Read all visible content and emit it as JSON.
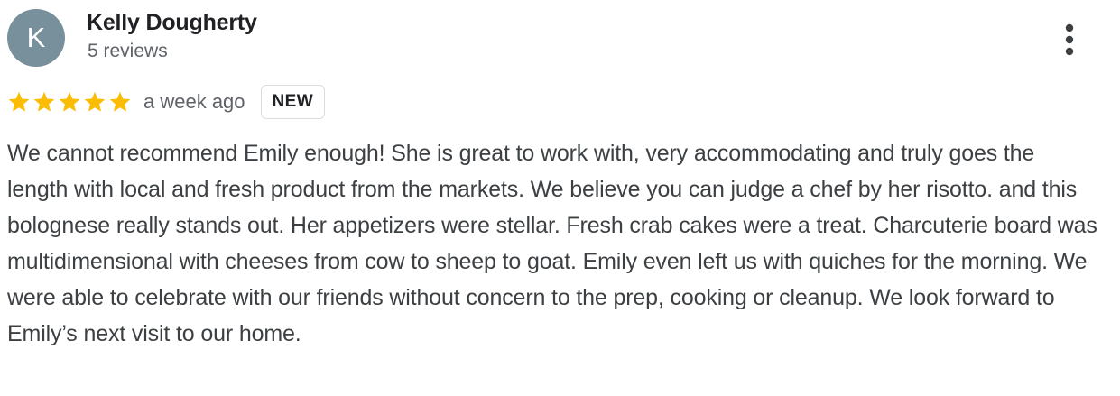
{
  "reviewer": {
    "avatar_letter": "K",
    "avatar_color": "#78909c",
    "name": "Kelly Dougherty",
    "meta": "5 reviews"
  },
  "menu": {
    "icon": "more-vert-icon"
  },
  "rating": {
    "stars": 5,
    "max_stars": 5,
    "star_color": "#fbbc04",
    "time": "a week ago",
    "badge": "NEW"
  },
  "review": {
    "text": "We cannot recommend Emily enough! She is great to work with, very accommodating and truly goes the length with local and fresh product from the markets. We believe you can judge a chef by her risotto. and this bolognese really stands out. Her appetizers were stellar. Fresh crab cakes were a treat. Charcuterie board was multidimensional with cheeses from cow to sheep to goat. Emily even left us with quiches for the morning. We were able to celebrate with our friends without concern to the prep, cooking or cleanup. We look forward to Emily’s next visit to our home."
  }
}
